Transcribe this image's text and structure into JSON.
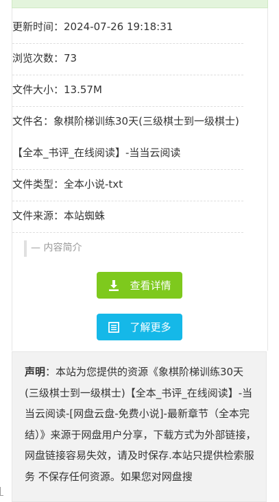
{
  "info": {
    "updated_label": "更新时间：",
    "updated_value": "2024-07-26 19:18:31",
    "views_label": "浏览次数：",
    "views_value": "73",
    "size_label": "文件大小：",
    "size_value": "13.57M",
    "name_label": "文件名：",
    "name_value": "象棋阶梯训练30天(三级棋士到一级棋士)【全本_书评_在线阅读】-当当云阅读",
    "type_label": "文件类型：",
    "type_value": "全本小说-txt",
    "source_label": "文件来源：",
    "source_value": "本站蜘蛛"
  },
  "intro_label": "内容简介",
  "buttons": {
    "details": "查看详情",
    "more": "了解更多"
  },
  "notice": {
    "title": "声明",
    "text": "：本站为您提供的资源《象棋阶梯训练30天(三级棋士到一级棋士)【全本_书评_在线阅读】-当当云阅读-[网盘云盘-免费小说]-最新章节（全本完结）》来源于网盘用户分享，下载方式为外部链接，网盘链接容易失效，请及时保存.本站只提供检索服务 不保存任何资源。如果您对网盘搜"
  },
  "colors": {
    "green_button": "#7ec91d",
    "blue_button": "#15b8e8",
    "top_bar": "#e3f4dc"
  },
  "icons": [
    "download-icon",
    "list-icon"
  ]
}
